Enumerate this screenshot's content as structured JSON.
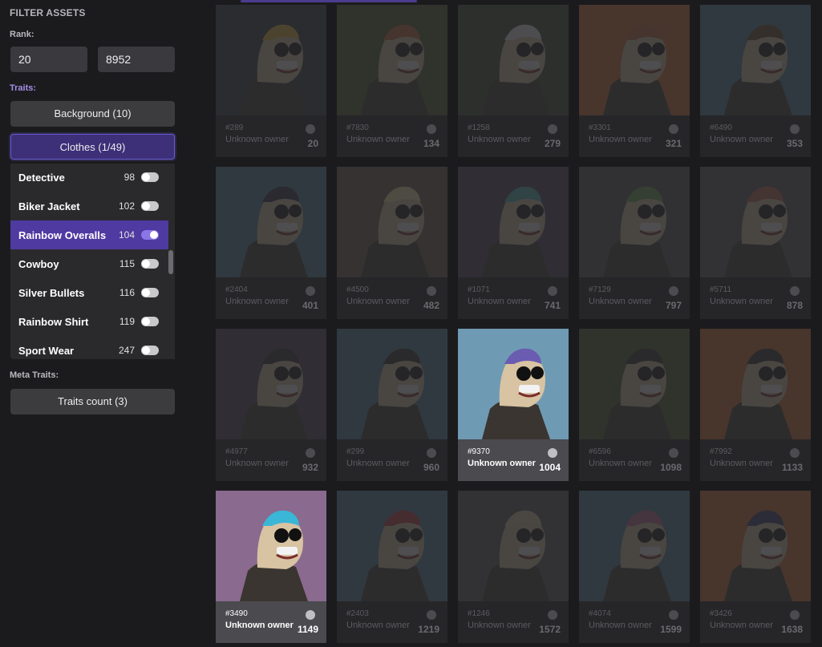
{
  "filter": {
    "title": "FILTER ASSETS",
    "rank_label": "Rank:",
    "rank_min": "20",
    "rank_max": "8952",
    "traits_label": "Traits:",
    "background_button": "Background (10)",
    "clothes_button": "Clothes (1/49)",
    "meta_label": "Meta Traits:",
    "traits_count_button": "Traits count (3)"
  },
  "traits": [
    {
      "name": "Detective",
      "count": "98",
      "on": false
    },
    {
      "name": "Biker Jacket",
      "count": "102",
      "on": false
    },
    {
      "name": "Rainbow Overalls",
      "count": "104",
      "on": true
    },
    {
      "name": "Cowboy",
      "count": "115",
      "on": false
    },
    {
      "name": "Silver Bullets",
      "count": "116",
      "on": false
    },
    {
      "name": "Rainbow Shirt",
      "count": "119",
      "on": false
    },
    {
      "name": "Sport Wear",
      "count": "247",
      "on": false
    }
  ],
  "cards": [
    {
      "id": "#289",
      "owner": "Unknown owner",
      "rank": "20",
      "bg": "#2a3540",
      "hair": "#e8b63a",
      "hi": false
    },
    {
      "id": "#7830",
      "owner": "Unknown owner",
      "rank": "134",
      "bg": "#4d5a2c",
      "hair": "#c66a3a",
      "hi": false
    },
    {
      "id": "#1258",
      "owner": "Unknown owner",
      "rank": "279",
      "bg": "#3f4a2e",
      "hair": "#eeeeee",
      "hi": false
    },
    {
      "id": "#3301",
      "owner": "Unknown owner",
      "rank": "321",
      "bg": "#d06a2a",
      "hair": "#c66a3a",
      "hi": false
    },
    {
      "id": "#6490",
      "owner": "Unknown owner",
      "rank": "353",
      "bg": "#4f7d94",
      "hair": "#6b4a2a",
      "hi": false
    },
    {
      "id": "#2404",
      "owner": "Unknown owner",
      "rank": "401",
      "bg": "#4f7d94",
      "hair": "#2a2a40",
      "hi": false
    },
    {
      "id": "#4500",
      "owner": "Unknown owner",
      "rank": "482",
      "bg": "#6d5a4a",
      "hair": "#f0e4a0",
      "hi": false
    },
    {
      "id": "#1071",
      "owner": "Unknown owner",
      "rank": "741",
      "bg": "#4d3f5a",
      "hair": "#4fb6b3",
      "hi": false
    },
    {
      "id": "#7129",
      "owner": "Unknown owner",
      "rank": "797",
      "bg": "#555555",
      "hair": "#6aa04a",
      "hi": false
    },
    {
      "id": "#5711",
      "owner": "Unknown owner",
      "rank": "878",
      "bg": "#5a5a5a",
      "hair": "#c06a4a",
      "hi": false
    },
    {
      "id": "#4977",
      "owner": "Unknown owner",
      "rank": "932",
      "bg": "#4d3f5a",
      "hair": "#2a2a2a",
      "hi": false
    },
    {
      "id": "#299",
      "owner": "Unknown owner",
      "rank": "960",
      "bg": "#4f7d94",
      "hair": "#2a2a2a",
      "hi": false
    },
    {
      "id": "#9370",
      "owner": "Unknown owner",
      "rank": "1004",
      "bg": "#6f9ab4",
      "hair": "#6a5cb0",
      "hi": true
    },
    {
      "id": "#6596",
      "owner": "Unknown owner",
      "rank": "1098",
      "bg": "#4d5a2c",
      "hair": "#2a2a2a",
      "hi": false
    },
    {
      "id": "#7992",
      "owner": "Unknown owner",
      "rank": "1133",
      "bg": "#d06a2a",
      "hair": "#2a2a2a",
      "hi": false
    },
    {
      "id": "#3490",
      "owner": "Unknown owner",
      "rank": "1149",
      "bg": "#8a6a8e",
      "hair": "#3ab6d6",
      "hi": true
    },
    {
      "id": "#2403",
      "owner": "Unknown owner",
      "rank": "1219",
      "bg": "#4f7d94",
      "hair": "#c03a3a",
      "hi": false
    },
    {
      "id": "#1246",
      "owner": "Unknown owner",
      "rank": "1572",
      "bg": "#5a5a5a",
      "hair": "#d9c9a0",
      "hi": false
    },
    {
      "id": "#4074",
      "owner": "Unknown owner",
      "rank": "1599",
      "bg": "#4f7d94",
      "hair": "#c06a8a",
      "hi": false
    },
    {
      "id": "#3426",
      "owner": "Unknown owner",
      "rank": "1638",
      "bg": "#d06a2a",
      "hair": "#3a3a6a",
      "hi": false
    }
  ]
}
